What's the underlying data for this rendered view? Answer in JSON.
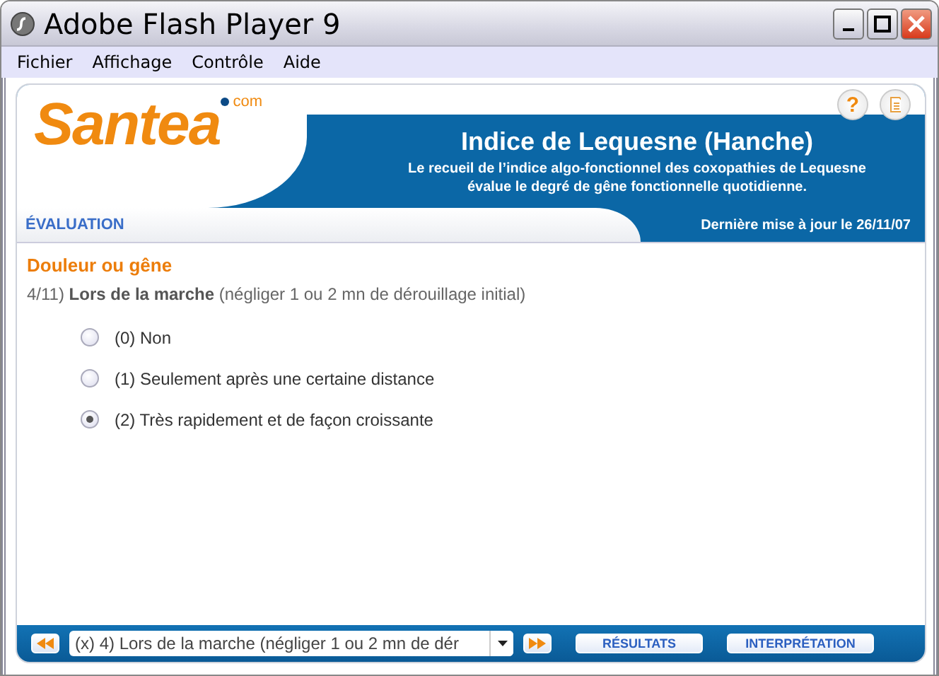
{
  "window": {
    "title": "Adobe Flash Player 9"
  },
  "menu": [
    "Fichier",
    "Affichage",
    "Contrôle",
    "Aide"
  ],
  "header": {
    "logo": "Santea",
    "logo_suffix": "com",
    "title": "Indice de Lequesne (Hanche)",
    "subtitle": "Le recueil de l’indice algo-fonctionnel des coxopathies de Lequesne évalue le degré de gêne fonctionnelle quotidienne.",
    "help": "?"
  },
  "section_strip": {
    "label": "ÉVALUATION",
    "updated": "Dernière mise à jour le 26/11/07"
  },
  "question": {
    "section": "Douleur ou gêne",
    "number": "4/11)",
    "title": "Lors de la marche",
    "note": "(négliger 1 ou 2 mn de dérouillage initial)"
  },
  "options": [
    {
      "label": "(0) Non",
      "selected": false
    },
    {
      "label": "(1) Seulement après une certaine distance",
      "selected": false
    },
    {
      "label": "(2) Très rapidement et de façon croissante",
      "selected": true
    }
  ],
  "footer": {
    "dropdown": "(x) 4) Lors de la marche (négliger 1 ou 2 mn de dér",
    "buttons": [
      "RÉSULTATS",
      "INTERPRÉTATION"
    ]
  }
}
